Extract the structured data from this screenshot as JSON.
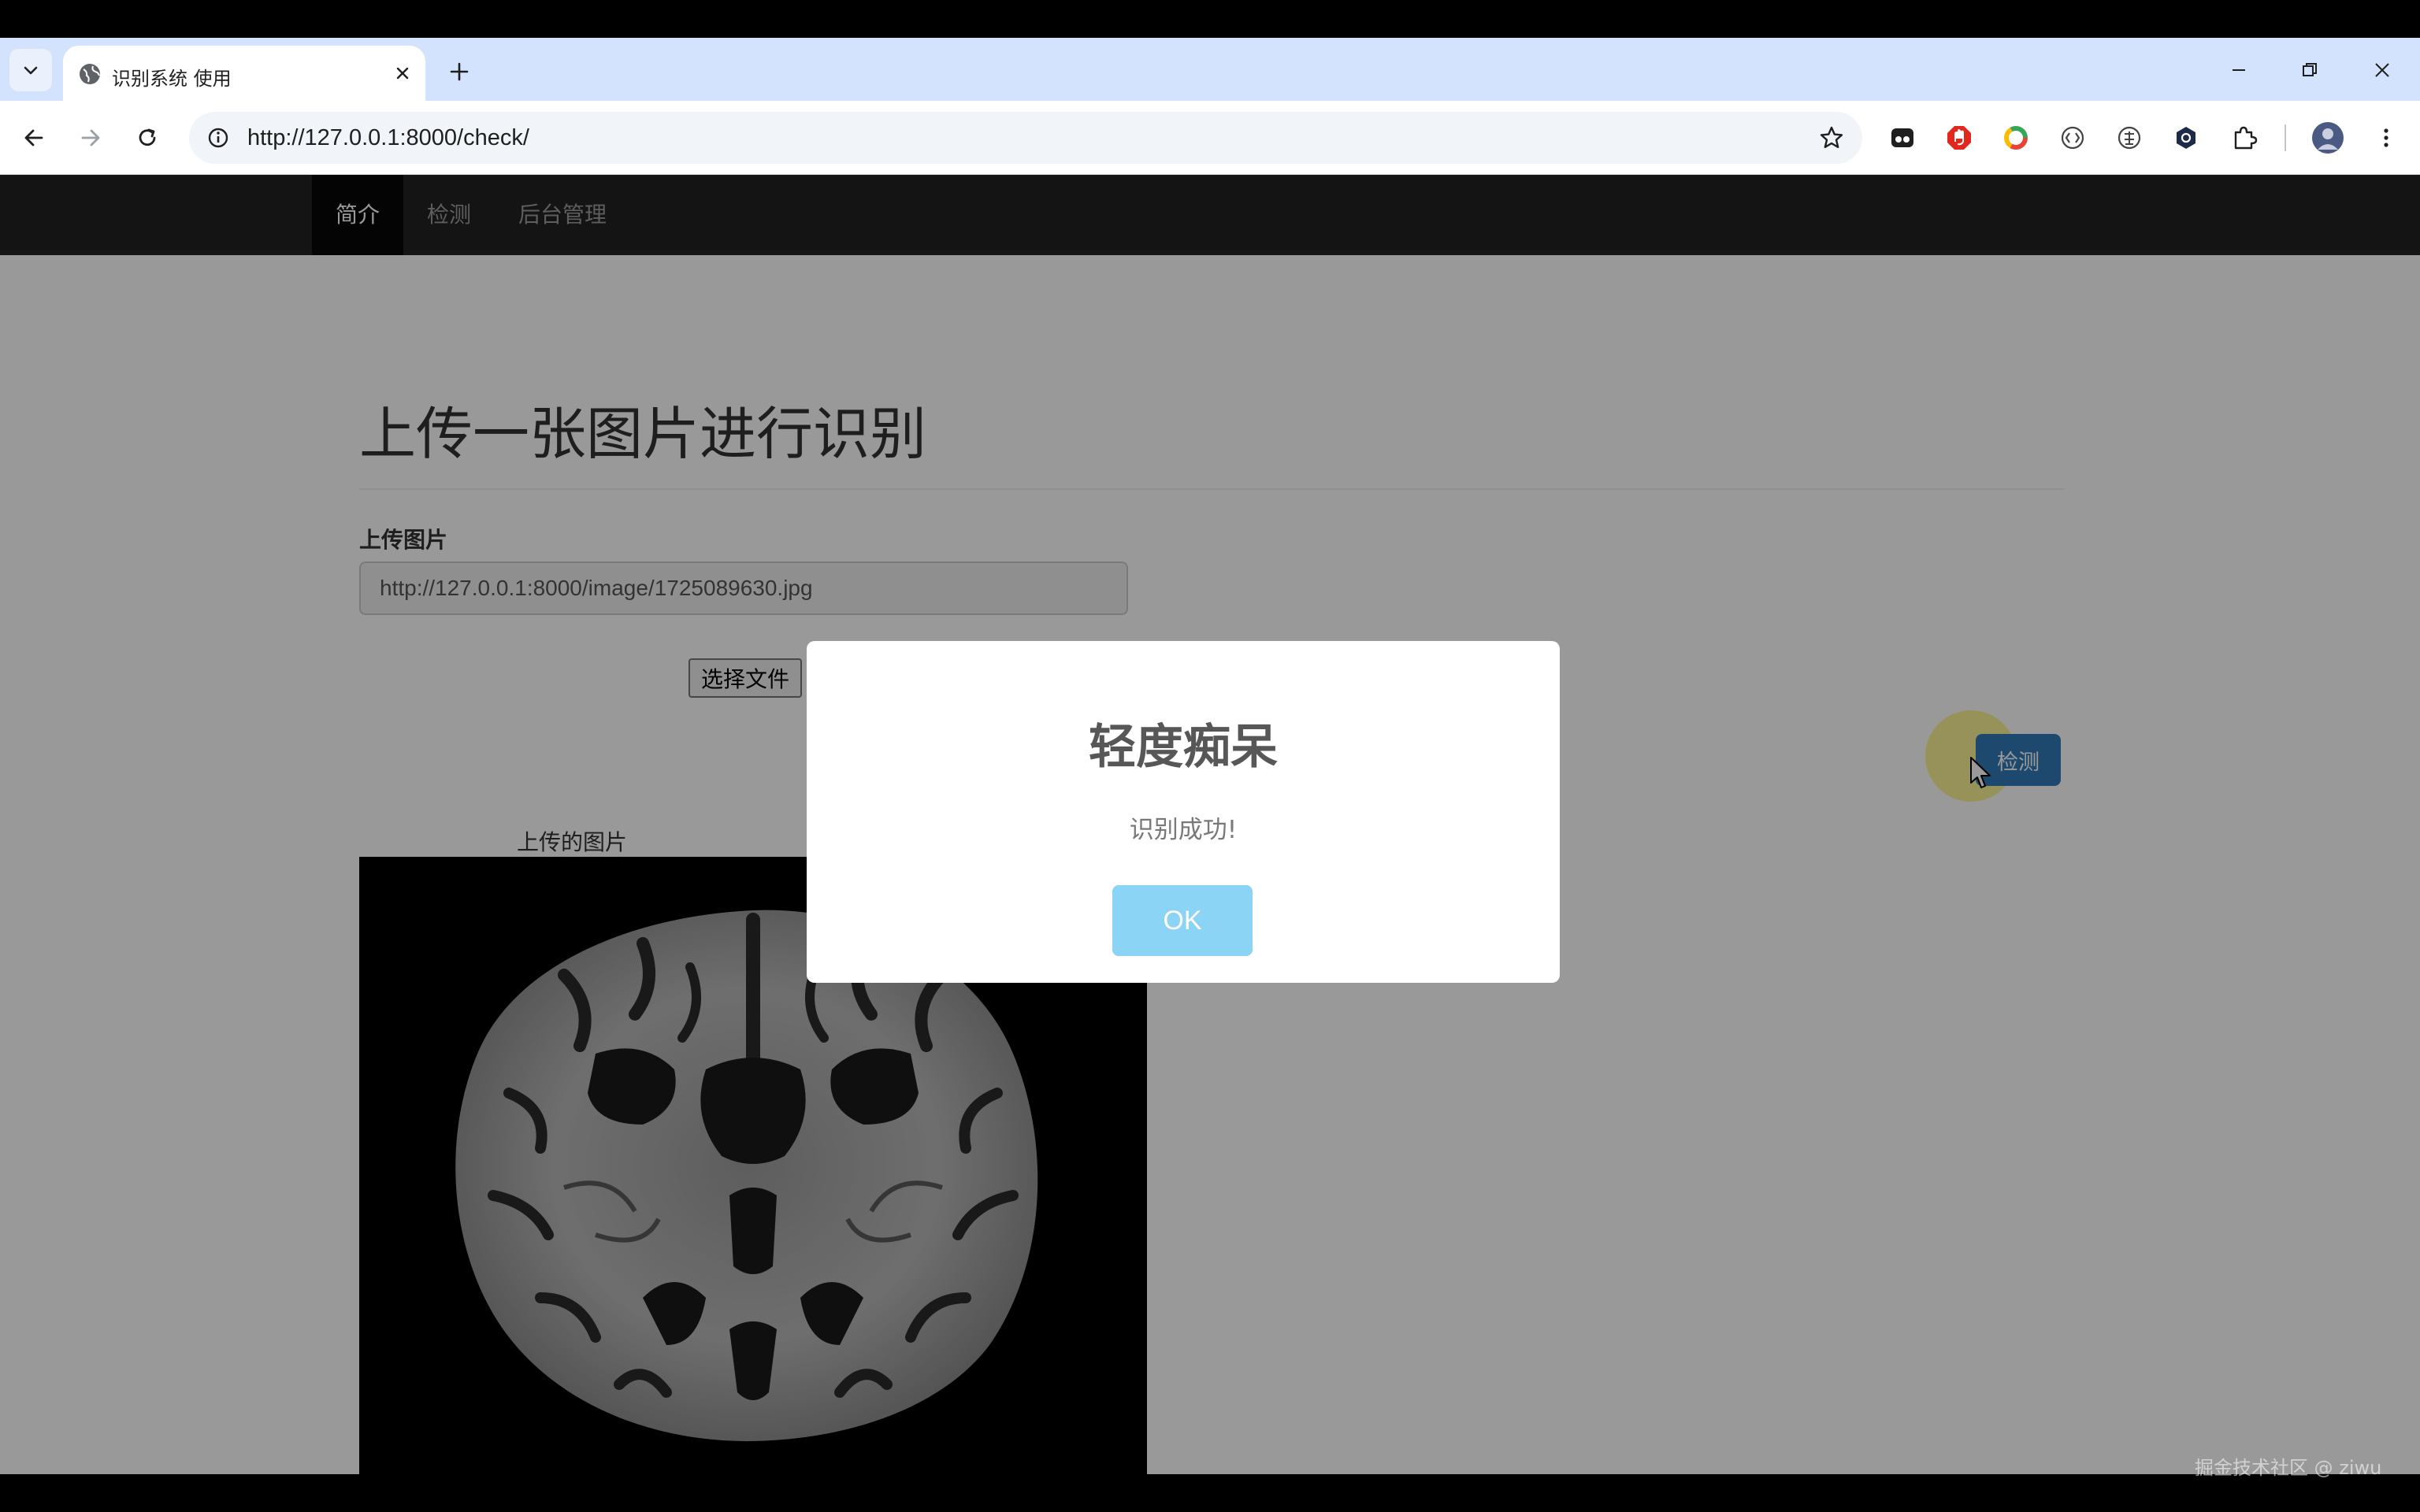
{
  "browser": {
    "tab_title": "识别系统 使用",
    "url": "http://127.0.0.1:8000/check/"
  },
  "navbar": {
    "items": [
      {
        "label": "简介",
        "active": true
      },
      {
        "label": "检测",
        "active": false
      },
      {
        "label": "后台管理",
        "active": false
      }
    ]
  },
  "main": {
    "title": "上传一张图片进行识别",
    "upload_label": "上传图片",
    "image_path_value": "http://127.0.0.1:8000/image/1725089630.jpg",
    "file_button_label": "选择文件",
    "detect_button_label": "检测",
    "image_caption": "上传的图片"
  },
  "modal": {
    "title": "轻度痴呆",
    "message": "识别成功!",
    "ok_label": "OK"
  },
  "watermark": "掘金技术社区 @ ziwu",
  "colors": {
    "tabstrip": "#d3e3fd",
    "navbar": "#222222",
    "primary_button": "#337ab7",
    "modal_ok": "#8cd4f5"
  }
}
